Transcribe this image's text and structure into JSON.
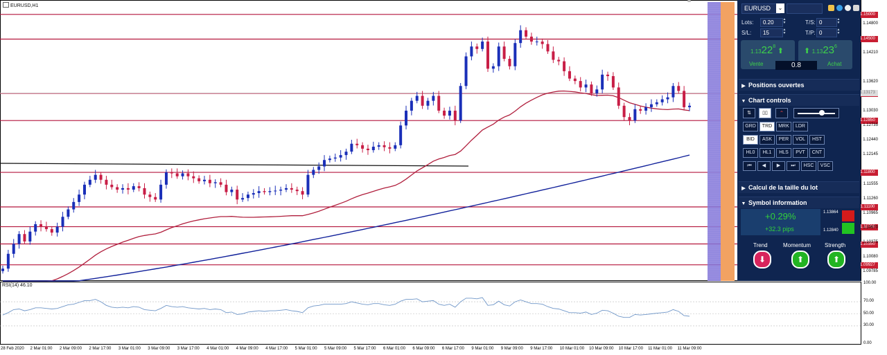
{
  "chart": {
    "symbol_tf": "EURUSD,H1",
    "rsi_label": "RSI(14) 46.10",
    "hlines": [
      {
        "price": 1.15,
        "label": "1.15000"
      },
      {
        "price": 1.145,
        "label": "1.14500"
      },
      {
        "price": 1.134,
        "label": "1.13400"
      },
      {
        "price": 1.1285,
        "label": "1.12850"
      },
      {
        "price": 1.118,
        "label": "1.11800"
      },
      {
        "price": 1.111,
        "label": "1.11100"
      },
      {
        "price": 1.107,
        "label": "1.10700"
      },
      {
        "price": 1.1035,
        "label": "1.10350"
      },
      {
        "price": 1.09927,
        "label": "1.09927"
      }
    ],
    "price_ticks": [
      "1.14800",
      "1.14210",
      "1.13620",
      "1.13030",
      "1.12735",
      "1.12440",
      "1.12145",
      "1.11555",
      "1.11260",
      "1.10965",
      "1.10670",
      "1.10375",
      "1.10080",
      "1.09785"
    ],
    "current_price_label": "1.13173",
    "rsi_ticks": [
      "100.00",
      "70.00",
      "50.00",
      "30.00",
      "0.00"
    ],
    "time_labels": [
      "28 Feb 2020",
      "2 Mar 01:00",
      "2 Mar 09:00",
      "2 Mar 17:00",
      "3 Mar 01:00",
      "3 Mar 09:00",
      "3 Mar 17:00",
      "4 Mar 01:00",
      "4 Mar 09:00",
      "4 Mar 17:00",
      "5 Mar 01:00",
      "5 Mar 09:00",
      "5 Mar 17:00",
      "6 Mar 01:00",
      "6 Mar 09:00",
      "6 Mar 17:00",
      "9 Mar 01:00",
      "9 Mar 09:00",
      "9 Mar 17:00",
      "10 Mar 01:00",
      "10 Mar 09:00",
      "10 Mar 17:00",
      "11 Mar 01:00",
      "11 Mar 09:00"
    ],
    "colors": {
      "bull": "#1a2fb8",
      "bear": "#c81e46",
      "ma_fast": "#b01e3c",
      "ma_slow": "#10209a",
      "hline": "#b4143c",
      "rsi": "#6f96c8"
    }
  },
  "chart_data": {
    "type": "candlestick",
    "title": "EURUSD,H1",
    "ylim": [
      1.096,
      1.1525
    ],
    "closes": [
      1.0985,
      1.1015,
      1.1035,
      1.1055,
      1.104,
      1.106,
      1.1075,
      1.107,
      1.1065,
      1.1058,
      1.107,
      1.109,
      1.1105,
      1.112,
      1.1135,
      1.1155,
      1.1165,
      1.1175,
      1.1165,
      1.1155,
      1.115,
      1.1145,
      1.1148,
      1.1145,
      1.1152,
      1.1148,
      1.1135,
      1.113,
      1.1125,
      1.1155,
      1.118,
      1.1178,
      1.1172,
      1.1178,
      1.1172,
      1.1168,
      1.1162,
      1.1165,
      1.1158,
      1.116,
      1.1155,
      1.114,
      1.1145,
      1.1125,
      1.1128,
      1.1135,
      1.1138,
      1.1142,
      1.114,
      1.1142,
      1.1143,
      1.1145,
      1.1148,
      1.1145,
      1.1142,
      1.1135,
      1.1175,
      1.1185,
      1.1192,
      1.1205,
      1.1208,
      1.121,
      1.1215,
      1.1222,
      1.1238,
      1.1235,
      1.1228,
      1.1225,
      1.1232,
      1.1235,
      1.1231,
      1.1228,
      1.1235,
      1.1275,
      1.1305,
      1.1325,
      1.1335,
      1.1315,
      1.1325,
      1.1335,
      1.1305,
      1.1295,
      1.1305,
      1.1285,
      1.1355,
      1.1415,
      1.1435,
      1.143,
      1.1445,
      1.139,
      1.1395,
      1.1435,
      1.141,
      1.1395,
      1.1442,
      1.1468,
      1.1455,
      1.1445,
      1.1445,
      1.144,
      1.1425,
      1.1408,
      1.1405,
      1.1385,
      1.137,
      1.1365,
      1.1352,
      1.1358,
      1.134,
      1.1348,
      1.1378,
      1.1375,
      1.1352,
      1.1315,
      1.1292,
      1.1285,
      1.1308,
      1.1305,
      1.1312,
      1.1318,
      1.1322,
      1.1328,
      1.1332,
      1.1355,
      1.1345,
      1.1312,
      1.1315
    ],
    "rsi": [
      48,
      52,
      57,
      58,
      55,
      57,
      60,
      60,
      59,
      58,
      59,
      62,
      65,
      66,
      69,
      72,
      72,
      74,
      70,
      64,
      61,
      60,
      61,
      60,
      62,
      61,
      57,
      56,
      55,
      59,
      64,
      62,
      61,
      62,
      60,
      59,
      58,
      59,
      57,
      58,
      57,
      52,
      53,
      49,
      50,
      53,
      54,
      55,
      54,
      55,
      55,
      56,
      57,
      55,
      54,
      52,
      60,
      63,
      64,
      66,
      66,
      66,
      66,
      67,
      70,
      68,
      66,
      65,
      67,
      67,
      65,
      64,
      66,
      71,
      74,
      74,
      75,
      70,
      71,
      72,
      66,
      64,
      66,
      61,
      70,
      76,
      76,
      75,
      77,
      64,
      65,
      71,
      65,
      63,
      70,
      73,
      70,
      67,
      67,
      66,
      62,
      59,
      58,
      55,
      52,
      52,
      51,
      53,
      49,
      51,
      56,
      55,
      51,
      46,
      44,
      44,
      49,
      48,
      49,
      50,
      51,
      52,
      53,
      57,
      54,
      47,
      46
    ]
  },
  "panel": {
    "symbol": "EURUSD",
    "lots_label": "Lots:",
    "lots_value": "0.20",
    "sl_label": "S/L:",
    "sl_value": "15",
    "ts_label": "T/S:",
    "ts_value": "0",
    "tp_label": "T/P:",
    "tp_value": "0",
    "sell": {
      "prefix": "1.13",
      "big": "22",
      "sup": "8",
      "label": "Vente"
    },
    "buy": {
      "prefix": "1.13",
      "big": "23",
      "sup": "6",
      "label": "Achat"
    },
    "spread": "0.8",
    "sections": {
      "open_positions": "Positions ouvertes",
      "chart_controls": "Chart controls",
      "lot_calc": "Calcul de la taille du lot",
      "symbol_info": "Symbol information"
    },
    "controls": {
      "row1": [
        "GRD",
        "TRD",
        "MRK",
        "LDR"
      ],
      "row2": [
        "BID",
        "ASK",
        "PER",
        "VOL",
        "HST"
      ],
      "row3": [
        "HL0",
        "HL1",
        "HLS",
        "PVT",
        "CNT"
      ],
      "row4": [
        "⏮",
        "◀",
        "▶",
        "⏭",
        "HSC",
        "VSC"
      ],
      "active": [
        "TRD",
        "BID"
      ]
    },
    "info": {
      "change_pct": "+0.29%",
      "change_pips": "+32.3 pips",
      "high": "1.13864",
      "low": "1.12840",
      "trend": "Trend",
      "momentum": "Momentum",
      "strength": "Strength"
    },
    "colors": {
      "bg": "#0f2550",
      "green": "#22c422",
      "red": "#d31b1b",
      "pink": "#d8245c"
    }
  }
}
